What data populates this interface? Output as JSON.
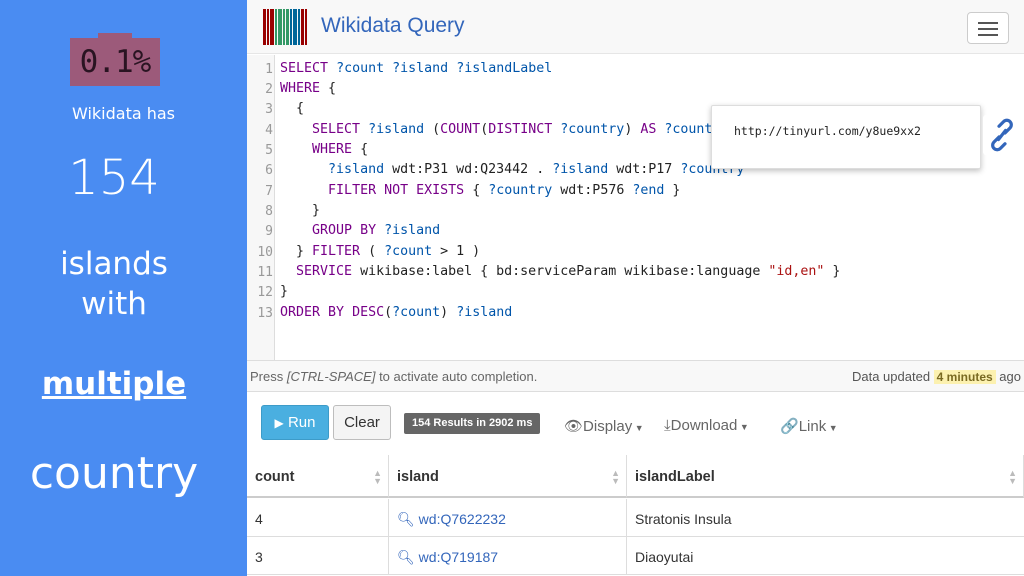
{
  "slide": {
    "percent": "0.1%",
    "intro": "Wikidata has",
    "count": "154",
    "line1": "islands",
    "line2": "with",
    "line3": "multiple",
    "line4": "country"
  },
  "app": {
    "title": "Wikidata Query",
    "brand_color": "#3366bb",
    "panel_color": "#4a8cf2"
  },
  "editor": {
    "line_numbers": [
      "1",
      "2",
      "3",
      "4",
      "5",
      "6",
      "7",
      "8",
      "9",
      "10",
      "11",
      "12",
      "13"
    ],
    "lines": [
      "SELECT ?count ?island ?islandLabel",
      "WHERE {",
      "  {",
      "    SELECT ?island (COUNT(DISTINCT ?country) AS ?count)",
      "    WHERE {",
      "      ?island wdt:P31 wd:Q23442 . ?island wdt:P17 ?country",
      "      FILTER NOT EXISTS { ?country wdt:P576 ?end }",
      "    }",
      "    GROUP BY ?island",
      "  } FILTER ( ?count > 1 )",
      "  SERVICE wikibase:label { bd:serviceParam wikibase:language \"id,en\" }",
      "}",
      "ORDER BY DESC(?count) ?island"
    ]
  },
  "popup": {
    "url": "http://tinyurl.com/y8ue9xx2"
  },
  "status": {
    "hint_prefix": "Press ",
    "hint_keys": "[CTRL-SPACE]",
    "hint_suffix": " to activate auto completion.",
    "updated_prefix": "Data updated ",
    "updated_value": "4 minutes",
    "updated_suffix": " ago"
  },
  "toolbar": {
    "run_label": "Run",
    "clear_label": "Clear",
    "results_label": "154 Results in 2902 ms",
    "display_label": "Display",
    "download_label": "Download",
    "link_label": "Link"
  },
  "table": {
    "columns": [
      "count",
      "island",
      "islandLabel"
    ],
    "rows": [
      {
        "count": "4",
        "island": "wd:Q7622232",
        "label": "Stratonis Insula"
      },
      {
        "count": "3",
        "island": "wd:Q719187",
        "label": "Diaoyutai"
      }
    ]
  }
}
